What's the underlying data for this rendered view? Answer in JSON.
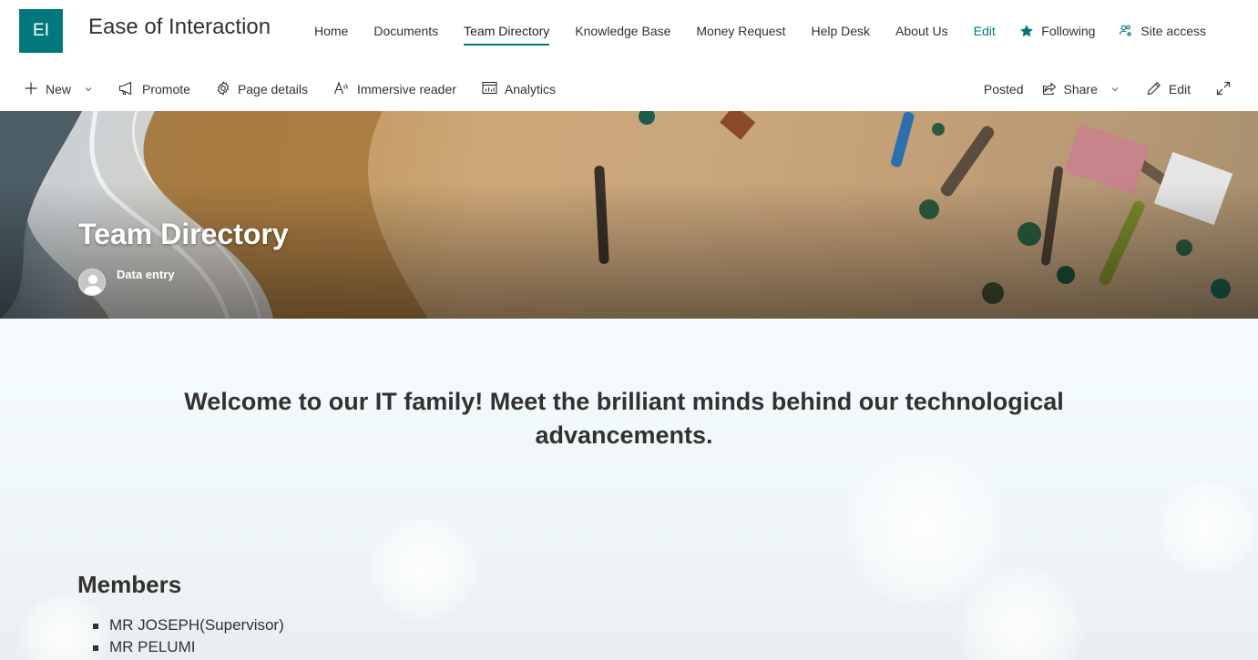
{
  "site": {
    "logo_initials": "EI",
    "title": "Ease of Interaction",
    "accent_color": "#03787c"
  },
  "topnav": {
    "items": [
      {
        "label": "Home"
      },
      {
        "label": "Documents"
      },
      {
        "label": "Team Directory",
        "active": true
      },
      {
        "label": "Knowledge Base"
      },
      {
        "label": "Money Request"
      },
      {
        "label": "Help Desk"
      },
      {
        "label": "About Us"
      }
    ],
    "edit_label": "Edit"
  },
  "header_actions": {
    "following": {
      "label": "Following",
      "icon": "star-filled-icon"
    },
    "site_access": {
      "label": "Site access",
      "icon": "people-settings-icon"
    }
  },
  "commandbar": {
    "left": [
      {
        "label": "New",
        "icon": "plus-icon",
        "has_dropdown": true
      },
      {
        "label": "Promote",
        "icon": "megaphone-icon"
      },
      {
        "label": "Page details",
        "icon": "gear-icon"
      },
      {
        "label": "Immersive reader",
        "icon": "immersive-reader-icon"
      },
      {
        "label": "Analytics",
        "icon": "analytics-icon"
      }
    ],
    "right": {
      "status": "Posted",
      "share": {
        "label": "Share",
        "icon": "share-icon",
        "has_dropdown": true
      },
      "edit": {
        "label": "Edit",
        "icon": "pencil-icon"
      },
      "expand_icon": "expand-icon"
    }
  },
  "hero": {
    "title": "Team Directory",
    "author": "Data entry"
  },
  "content": {
    "welcome": "Welcome to our IT family! Meet the brilliant minds behind our technological advancements.",
    "members_heading": "Members",
    "members": [
      "MR JOSEPH(Supervisor)",
      "MR PELUMI"
    ]
  }
}
